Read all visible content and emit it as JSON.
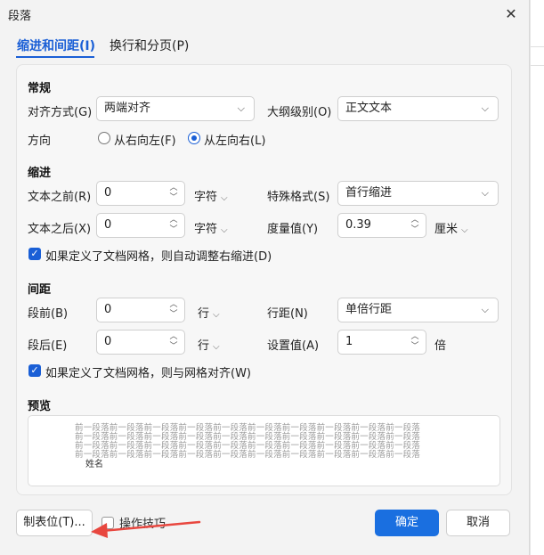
{
  "dialog": {
    "title": "段落",
    "close_glyph": "✕"
  },
  "tabs": [
    {
      "label": "缩进和间距(I)"
    },
    {
      "label": "换行和分页(P)"
    }
  ],
  "general": {
    "heading": "常规",
    "alignment_label": "对齐方式(G)",
    "alignment_value": "两端对齐",
    "outline_label": "大纲级别(O)",
    "outline_value": "正文文本",
    "direction_label": "方向",
    "rtl_label": "从右向左(F)",
    "ltr_label": "从左向右(L)",
    "direction_selected": "ltr"
  },
  "indent": {
    "heading": "缩进",
    "before_label": "文本之前(R)",
    "before_value": "0",
    "before_unit": "字符",
    "special_label": "特殊格式(S)",
    "special_value": "首行缩进",
    "after_label": "文本之后(X)",
    "after_value": "0",
    "after_unit": "字符",
    "measure_label": "度量值(Y)",
    "measure_value": "0.39",
    "measure_unit": "厘米",
    "grid_check_label": "如果定义了文档网格，则自动调整右缩进(D)",
    "grid_checked": true
  },
  "spacing": {
    "heading": "间距",
    "before_label": "段前(B)",
    "before_value": "0",
    "before_unit": "行",
    "line_label": "行距(N)",
    "line_value": "单倍行距",
    "after_label": "段后(E)",
    "after_value": "0",
    "after_unit": "行",
    "setting_label": "设置值(A)",
    "setting_value": "1",
    "setting_unit": "倍",
    "grid_check_label": "如果定义了文档网格，则与网格对齐(W)",
    "grid_checked": true
  },
  "preview": {
    "heading": "预览",
    "lines": [
      "前一段落前一段落前一段落前一段落前一段落前一段落前一段落前一段落前一段落前一段落",
      "前一段落前一段落前一段落前一段落前一段落前一段落前一段落前一段落前一段落前一段落",
      "前一段落前一段落前一段落前一段落前一段落前一段落前一段落前一段落前一段落前一段落",
      "前一段落前一段落前一段落前一段落前一段落前一段落前一段落前一段落前一段落前一段落"
    ],
    "sample_text": "姓名"
  },
  "footer": {
    "tabs_button": "制表位(T)...",
    "tips_label": "操作技巧",
    "ok_button": "确定",
    "cancel_button": "取消"
  },
  "colors": {
    "accent": "#1a5fd6",
    "primary_button": "#1a6fe0",
    "annotation_arrow": "#e8473f"
  },
  "icons": {
    "chevron": "chevron-down-icon",
    "spinner": "spinner-arrows-icon",
    "check": "checkmark-icon",
    "close": "close-icon"
  }
}
